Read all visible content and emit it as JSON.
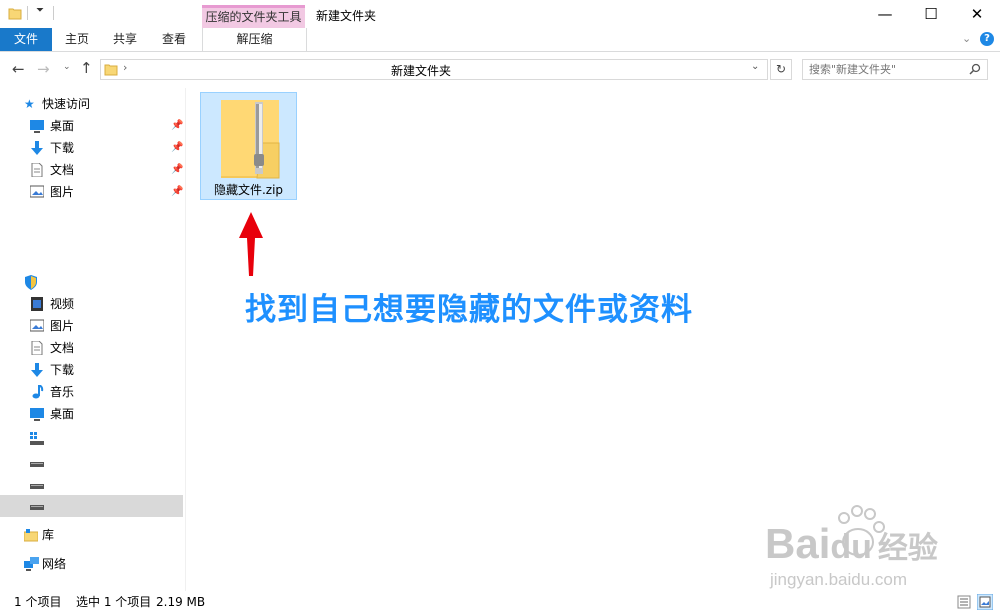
{
  "titlebar": {
    "context_tab_header": "压缩的文件夹工具",
    "window_title": "新建文件夹",
    "minimize": "—",
    "maximize": "☐",
    "close": "✕"
  },
  "ribbon": {
    "tabs": [
      {
        "label": "文件"
      },
      {
        "label": "主页"
      },
      {
        "label": "共享"
      },
      {
        "label": "查看"
      },
      {
        "label": "解压缩"
      }
    ]
  },
  "address": {
    "path": "新建文件夹",
    "search_placeholder": "搜索\"新建文件夹\""
  },
  "nav": {
    "quick_access": "快速访问",
    "quick_items": [
      {
        "label": "桌面",
        "icon": "desktop-icon"
      },
      {
        "label": "下载",
        "icon": "download-icon"
      },
      {
        "label": "文档",
        "icon": "document-icon"
      },
      {
        "label": "图片",
        "icon": "pictures-icon"
      }
    ],
    "pc_items": [
      {
        "label": "视频",
        "icon": "video-icon"
      },
      {
        "label": "图片",
        "icon": "pictures-icon"
      },
      {
        "label": "文档",
        "icon": "document-icon"
      },
      {
        "label": "下载",
        "icon": "download-icon"
      },
      {
        "label": "音乐",
        "icon": "music-icon"
      },
      {
        "label": "桌面",
        "icon": "desktop-icon"
      }
    ],
    "library": "库",
    "network": "网络"
  },
  "content": {
    "file_name": "隐藏文件.zip",
    "annotation": "找到自己想要隐藏的文件或资料"
  },
  "status": {
    "item_count": "1 个项目",
    "selected": "选中 1 个项目",
    "size": "2.19 MB"
  },
  "watermark": {
    "brand": "Bai",
    "brand2": "du",
    "brand_cn": "经验",
    "url": "jingyan.baidu.com"
  },
  "colors": {
    "accent": "#1979ca",
    "context_tab": "#f2c9e3",
    "selection": "#cce8ff",
    "annotation": "#1e90ff",
    "arrow": "#e8000b"
  }
}
